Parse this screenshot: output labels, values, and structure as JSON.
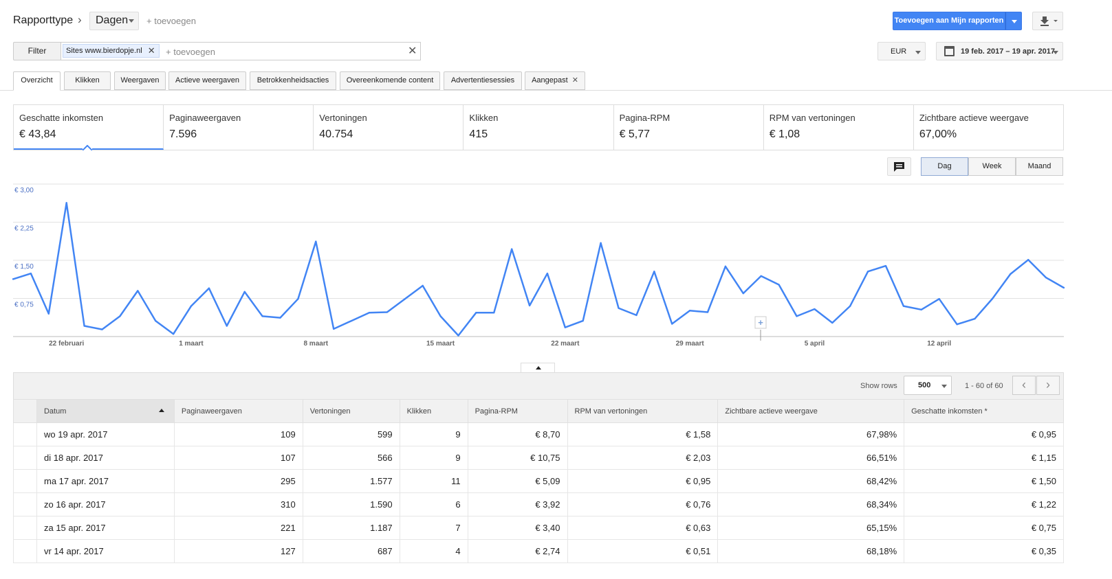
{
  "header": {
    "title": "Rapporttype",
    "dimension": "Dagen",
    "add_label": "+ toevoegen",
    "save_button": "Toevoegen aan Mijn rapporten",
    "accent": "#4285f4"
  },
  "filter": {
    "button": "Filter",
    "chip": "Sites www.bierdopje.nl",
    "add_label": "+ toevoegen",
    "currency": "EUR",
    "date_range": "19 feb. 2017 – 19 apr. 2017"
  },
  "tabs": [
    {
      "label": "Overzicht"
    },
    {
      "label": "Klikken"
    },
    {
      "label": "Weergaven"
    },
    {
      "label": "Actieve weergaven"
    },
    {
      "label": "Betrokkenheidsacties"
    },
    {
      "label": "Overeenkomende content"
    },
    {
      "label": "Advertentiesessies"
    },
    {
      "label": "Aangepast"
    }
  ],
  "metrics": [
    {
      "label": "Geschatte inkomsten",
      "value": "€ 43,84"
    },
    {
      "label": "Paginaweergaven",
      "value": "7.596"
    },
    {
      "label": "Vertoningen",
      "value": "40.754"
    },
    {
      "label": "Klikken",
      "value": "415"
    },
    {
      "label": "Pagina-RPM",
      "value": "€ 5,77"
    },
    {
      "label": "RPM van vertoningen",
      "value": "€ 1,08"
    },
    {
      "label": "Zichtbare actieve weergave",
      "value": "67,00%"
    }
  ],
  "granularity": {
    "day": "Dag",
    "week": "Week",
    "month": "Maand"
  },
  "chart_data": {
    "type": "line",
    "ylim": [
      0,
      3.0
    ],
    "yticks": [
      "€ 3,00",
      "€ 2,25",
      "€ 1,50",
      "€ 0,75"
    ],
    "ytick_values": [
      3.0,
      2.25,
      1.5,
      0.75
    ],
    "xtick_labels": [
      "22 februari",
      "1 maart",
      "8 maart",
      "15 maart",
      "22 maart",
      "29 maart",
      "5 april",
      "12 april"
    ],
    "xtick_indices": [
      3,
      10,
      17,
      24,
      31,
      38,
      45,
      52
    ],
    "line_color": "#4285f4",
    "grid": true,
    "values": [
      1.13,
      1.24,
      0.45,
      2.63,
      0.21,
      0.14,
      0.4,
      0.9,
      0.31,
      0.05,
      0.6,
      0.95,
      0.21,
      0.88,
      0.4,
      0.37,
      0.74,
      1.87,
      0.15,
      0.31,
      0.47,
      0.48,
      0.74,
      1.0,
      0.4,
      0.02,
      0.47,
      0.47,
      1.72,
      0.61,
      1.24,
      0.18,
      0.31,
      1.84,
      0.56,
      0.42,
      1.28,
      0.25,
      0.51,
      0.48,
      1.38,
      0.85,
      1.19,
      1.02,
      0.4,
      0.54,
      0.27,
      0.6,
      1.28,
      1.39,
      0.6,
      0.53,
      0.74,
      0.24,
      0.35,
      0.75,
      1.23,
      1.51,
      1.16,
      0.96
    ]
  },
  "table": {
    "show_rows_label": "Show rows",
    "rows_value": "500",
    "range_label": "1 - 60 of 60",
    "columns": [
      "Datum",
      "Paginaweergaven",
      "Vertoningen",
      "Klikken",
      "Pagina-RPM",
      "RPM van vertoningen",
      "Zichtbare actieve weergave",
      "Geschatte inkomsten *"
    ],
    "rows": [
      [
        "wo 19 apr. 2017",
        "109",
        "599",
        "9",
        "€ 8,70",
        "€ 1,58",
        "67,98%",
        "€ 0,95"
      ],
      [
        "di 18 apr. 2017",
        "107",
        "566",
        "9",
        "€ 10,75",
        "€ 2,03",
        "66,51%",
        "€ 1,15"
      ],
      [
        "ma 17 apr. 2017",
        "295",
        "1.577",
        "11",
        "€ 5,09",
        "€ 0,95",
        "68,42%",
        "€ 1,50"
      ],
      [
        "zo 16 apr. 2017",
        "310",
        "1.590",
        "6",
        "€ 3,92",
        "€ 0,76",
        "68,34%",
        "€ 1,22"
      ],
      [
        "za 15 apr. 2017",
        "221",
        "1.187",
        "7",
        "€ 3,40",
        "€ 0,63",
        "65,15%",
        "€ 0,75"
      ],
      [
        "vr 14 apr. 2017",
        "127",
        "687",
        "4",
        "€ 2,74",
        "€ 0,51",
        "68,18%",
        "€ 0,35"
      ]
    ]
  }
}
